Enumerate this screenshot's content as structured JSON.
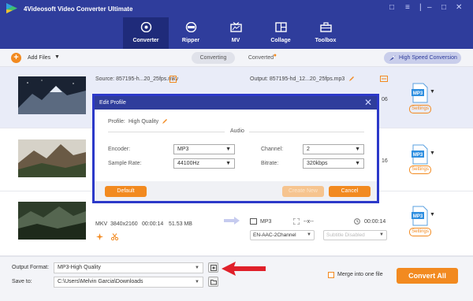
{
  "app": {
    "title": "4Videosoft Video Converter Ultimate"
  },
  "nav": {
    "tabs": [
      {
        "label": "Converter",
        "icon": "converter-icon",
        "active": true
      },
      {
        "label": "Ripper",
        "icon": "ripper-icon"
      },
      {
        "label": "MV",
        "icon": "mv-icon"
      },
      {
        "label": "Collage",
        "icon": "collage-icon"
      },
      {
        "label": "Toolbox",
        "icon": "toolbox-icon"
      }
    ]
  },
  "toolbar": {
    "add_files": "Add Files",
    "converting": "Converting",
    "converted": "Converted",
    "high_speed": "High Speed Conversion"
  },
  "files": [
    {
      "source": "Source: 857195-h...20_25fps.mkv",
      "output": "Output: 857195-hd_12...20_25fps.mp3",
      "format": "MP3",
      "settings": "Settings",
      "duration_partial": "06"
    },
    {
      "format": "MP3",
      "settings": "Settings",
      "duration_partial": "16"
    },
    {
      "container": "MKV",
      "resolution": "3840x2160",
      "duration": "00:00:14",
      "size": "51.53 MB",
      "out_format": "MP3",
      "out_res": "--x--",
      "out_duration": "00:00:14",
      "audio_track": "EN-AAC-2Channel",
      "subtitle": "Subtitle Disabled",
      "format": "MP3",
      "settings": "Settings"
    }
  ],
  "bottom": {
    "output_format_label": "Output Format:",
    "output_format_value": "MP3-High Quality",
    "save_to_label": "Save to:",
    "save_to_value": "C:\\Users\\Melvin Garcia\\Downloads",
    "merge_label": "Merge into one file",
    "convert_all": "Convert All"
  },
  "modal": {
    "title": "Edit Profile",
    "profile_label": "Profile:",
    "profile_value": "High Quality",
    "section": "Audio",
    "encoder_label": "Encoder:",
    "encoder_value": "MP3",
    "channel_label": "Channel:",
    "channel_value": "2",
    "sample_rate_label": "Sample Rate:",
    "sample_rate_value": "44100Hz",
    "bitrate_label": "Bitrate:",
    "bitrate_value": "320kbps",
    "default_btn": "Default",
    "create_new_btn": "Create New",
    "cancel_btn": "Cancel"
  },
  "colors": {
    "accent": "#f28a20",
    "brand": "#2f3d9c",
    "modal_border": "#2c39c9",
    "arrow": "#e0202a"
  }
}
